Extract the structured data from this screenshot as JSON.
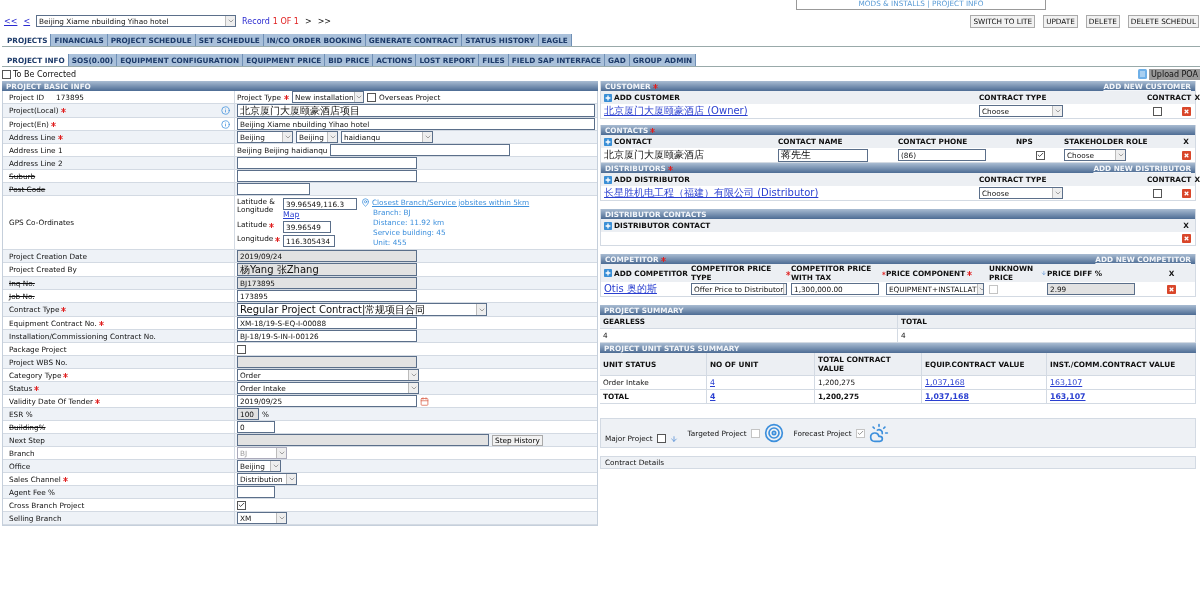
{
  "header_box": {
    "text": "MODS & INSTALLS | PROJECT INFO"
  },
  "nav": {
    "first": "<<",
    "prev": "<",
    "project": "Beijing Xiame nbuilding Yihao hotel",
    "record_label": "Record",
    "record_count": "1 OF 1",
    "next": ">",
    "last": ">>"
  },
  "actions": [
    "SWITCH TO LITE",
    "UPDATE",
    "DELETE",
    "DELETE SCHEDUL"
  ],
  "tabs": [
    {
      "label": "PROJECTS",
      "selected": true
    },
    {
      "label": "FINANCIALS",
      "selected": false
    },
    {
      "label": "PROJECT SCHEDULE",
      "selected": false
    },
    {
      "label": "SET SCHEDULE",
      "selected": false
    },
    {
      "label": "IN/CO ORDER BOOKING",
      "selected": false
    },
    {
      "label": "GENERATE CONTRACT",
      "selected": false
    },
    {
      "label": "STATUS HISTORY",
      "selected": false
    },
    {
      "label": "EAGLE",
      "selected": false
    }
  ],
  "subtabs": [
    {
      "label": "PROJECT INFO",
      "selected": true
    },
    {
      "label": "SOS(0.00)",
      "selected": false
    },
    {
      "label": "EQUIPMENT CONFIGURATION",
      "selected": false
    },
    {
      "label": "EQUIPMENT PRICE",
      "selected": false
    },
    {
      "label": "BID PRICE",
      "selected": false
    },
    {
      "label": "ACTIONS",
      "selected": false
    },
    {
      "label": "LOST REPORT",
      "selected": false
    },
    {
      "label": "FILES",
      "selected": false
    },
    {
      "label": "FIELD SAP INTERFACE",
      "selected": false
    },
    {
      "label": "GAD",
      "selected": false
    },
    {
      "label": "GROUP ADMIN",
      "selected": false
    }
  ],
  "to_be_corrected": {
    "label": "To Be Corrected",
    "checked": false
  },
  "upload_poa": "Upload POA",
  "basic_info": {
    "title": "PROJECT BASIC INFO",
    "rows": [
      {
        "kind": "id",
        "label": "Project ID",
        "value": "173895",
        "type_label": "Project Type",
        "type_required": true,
        "type_value": "New installation",
        "overseas_label": "Overseas Project",
        "overseas_checked": false
      },
      {
        "kind": "input",
        "label": "Project(Local)",
        "required": true,
        "info": true,
        "value": "北京厦门大厦颐豪酒店项目"
      },
      {
        "kind": "input",
        "label": "Project(En)",
        "required": true,
        "info": true,
        "value": "Beijing Xiame nbuilding Yihao hotel"
      },
      {
        "kind": "selects",
        "label": "Address Line",
        "required": true,
        "values": [
          "Beijing",
          "Beijing",
          "haidianqu"
        ]
      },
      {
        "kind": "prefixed",
        "label": "Address Line 1",
        "prefix": "Beijing Beijing haidianqu"
      },
      {
        "kind": "input",
        "label": "Address Line 2"
      },
      {
        "kind": "input",
        "label": "Suburb",
        "struck": true
      },
      {
        "kind": "input",
        "label": "Post Code",
        "struck": true
      },
      {
        "kind": "gps",
        "label": "GPS Co-Ordinates",
        "latlng_label": "Latitude & Longitude",
        "latlng_value": "39.96549,116.3",
        "map_link": "Map",
        "lat_label": "Latitude",
        "lat_value": "39.96549",
        "lng_label": "Longitude",
        "lng_value": "116.305434",
        "closest_link": "Closest Branch/Service jobsites within 5km",
        "details": [
          "Branch: BJ",
          "Distance: 11.92 km",
          "Service building: 45",
          "Unit: 455"
        ]
      },
      {
        "kind": "input",
        "label": "Project Creation Date",
        "value": "2019/09/24",
        "disabled": true
      },
      {
        "kind": "input",
        "label": "Project Created By",
        "value": "杨Yang 张Zhang",
        "disabled": true
      },
      {
        "kind": "input",
        "label": "Inq No.",
        "struck": true,
        "value": "BJ173895",
        "disabled": true
      },
      {
        "kind": "input",
        "label": "Job No.",
        "struck": true,
        "value": "173895"
      },
      {
        "kind": "select",
        "label": "Contract Type",
        "required": true,
        "value": "Regular Project Contract|常规项目合同"
      },
      {
        "kind": "input",
        "label": "Equipment Contract No.",
        "required": true,
        "value": "XM-18/19-S-EQ-I-00088"
      },
      {
        "kind": "input",
        "label": "Installation/Commissioning Contract No.",
        "value": "BJ-18/19-S-IN-I-00126"
      },
      {
        "kind": "checkbox",
        "label": "Package Project",
        "checked": false
      },
      {
        "kind": "input",
        "label": "Project WBS No.",
        "disabled": true
      },
      {
        "kind": "select",
        "label": "Category Type",
        "required": true,
        "value": "Order"
      },
      {
        "kind": "select",
        "label": "Status",
        "required": true,
        "value": "Order Intake"
      },
      {
        "kind": "date",
        "label": "Validity Date Of Tender",
        "required": true,
        "value": "2019/09/25"
      },
      {
        "kind": "unit",
        "label": "ESR %",
        "value": "100",
        "unit": "%",
        "disabled": true
      },
      {
        "kind": "input",
        "label": "Building%",
        "struck": true,
        "value": "0"
      },
      {
        "kind": "button",
        "label": "Next Step",
        "disabled": true,
        "button": "Step History"
      },
      {
        "kind": "select",
        "label": "Branch",
        "value": "BJ",
        "disabled": true
      },
      {
        "kind": "select",
        "label": "Office",
        "value": "Beijing"
      },
      {
        "kind": "select",
        "label": "Sales Channel",
        "required": true,
        "value": "Distribution"
      },
      {
        "kind": "input",
        "label": "Agent Fee %"
      },
      {
        "kind": "checkbox",
        "label": "Cross Branch Project",
        "checked": true
      },
      {
        "kind": "select",
        "label": "Selling Branch",
        "value": "XM"
      }
    ]
  },
  "customer": {
    "title": "CUSTOMER",
    "required": true,
    "link": "ADD NEW CUSTOMER",
    "columns": [
      {
        "label": "ADD CUSTOMER",
        "add": true
      },
      {
        "label": "CONTRACT TYPE"
      },
      {
        "label": "CONTRACT"
      },
      {
        "label": "X"
      }
    ],
    "rows": [
      {
        "name": "北京厦门大厦颐豪酒店 (Owner)",
        "contract_type": "Choose",
        "contract": false
      }
    ]
  },
  "contacts": {
    "title": "CONTACTS",
    "required": true,
    "columns": [
      {
        "label": "CONTACT",
        "add": true
      },
      {
        "label": "CONTACT NAME"
      },
      {
        "label": "CONTACT PHONE"
      },
      {
        "label": "NPS"
      },
      {
        "label": "STAKEHOLDER ROLE"
      },
      {
        "label": "X"
      }
    ],
    "rows": [
      {
        "contact": "北京厦门大厦颐豪酒店",
        "name": "蒋先生",
        "phone": "(86)",
        "nps": true,
        "role": "Choose"
      }
    ]
  },
  "distributors": {
    "title": "DISTRIBUTORS",
    "required": true,
    "link": "ADD NEW DISTRIBUTOR",
    "columns": [
      {
        "label": "ADD DISTRIBUTOR",
        "add": true
      },
      {
        "label": "CONTRACT TYPE"
      },
      {
        "label": "CONTRACT"
      },
      {
        "label": "X"
      }
    ],
    "rows": [
      {
        "name": "长星胜机电工程（福建）有限公司 (Distributor)",
        "contract_type": "Choose",
        "contract": false
      }
    ]
  },
  "distributor_contacts": {
    "title": "DISTRIBUTOR CONTACTS",
    "columns": [
      {
        "label": "DISTRIBUTOR CONTACT",
        "add": true
      },
      {
        "label": "X"
      }
    ]
  },
  "competitor": {
    "title": "COMPETITOR",
    "required": true,
    "link": "ADD NEW COMPETITOR",
    "columns": [
      {
        "label": "ADD COMPETITOR",
        "add": true
      },
      {
        "label": "COMPETITOR PRICE TYPE",
        "required": true
      },
      {
        "label": "COMPETITOR PRICE WITH TAX",
        "required": true
      },
      {
        "label": "PRICE COMPONENT",
        "required": true
      },
      {
        "label": "UNKNOWN PRICE",
        "hint": true
      },
      {
        "label": "PRICE DIFF %"
      },
      {
        "label": "X"
      }
    ],
    "rows": [
      {
        "name": "Otis 奥的斯",
        "price_type": "Offer Price to Distributor",
        "price": "1,300,000.00",
        "component": "EQUIPMENT+INSTALLAT",
        "unknown_price": {
          "checked": false,
          "disabled": true
        },
        "price_diff": {
          "value": "2.99",
          "disabled": true
        }
      }
    ]
  },
  "project_summary": {
    "title": "PROJECT SUMMARY",
    "columns": [
      "GEARLESS",
      "TOTAL"
    ],
    "rows": [
      [
        "4",
        "4"
      ]
    ]
  },
  "unit_status": {
    "title": "PROJECT UNIT STATUS SUMMARY",
    "columns": [
      "UNIT STATUS",
      "NO OF UNIT",
      "TOTAL CONTRACT VALUE",
      "EQUIP.CONTRACT VALUE",
      "INST./COMM.CONTRACT VALUE"
    ],
    "rows": [
      {
        "kind": "normal",
        "cells": [
          {
            "text": "Order Intake"
          },
          {
            "text": "4",
            "link": true
          },
          {
            "text": "1,200,275"
          },
          {
            "text": "1,037,168",
            "link": true
          },
          {
            "text": "163,107",
            "link": true
          }
        ]
      },
      {
        "kind": "total",
        "cells": [
          {
            "text": "TOTAL"
          },
          {
            "text": "4",
            "link": true
          },
          {
            "text": "1,200,275"
          },
          {
            "text": "1,037,168",
            "link": true
          },
          {
            "text": "163,107",
            "link": true
          }
        ]
      }
    ]
  },
  "flags": [
    {
      "label": "Major Project",
      "checked": false,
      "disabled": false,
      "kind": "arrow"
    },
    {
      "label": "Targeted Project",
      "checked": false,
      "disabled": true,
      "kind": "target"
    },
    {
      "label": "Forecast Project",
      "checked": true,
      "disabled": true,
      "kind": "cloud"
    }
  ],
  "contract_details": "Contract Details"
}
